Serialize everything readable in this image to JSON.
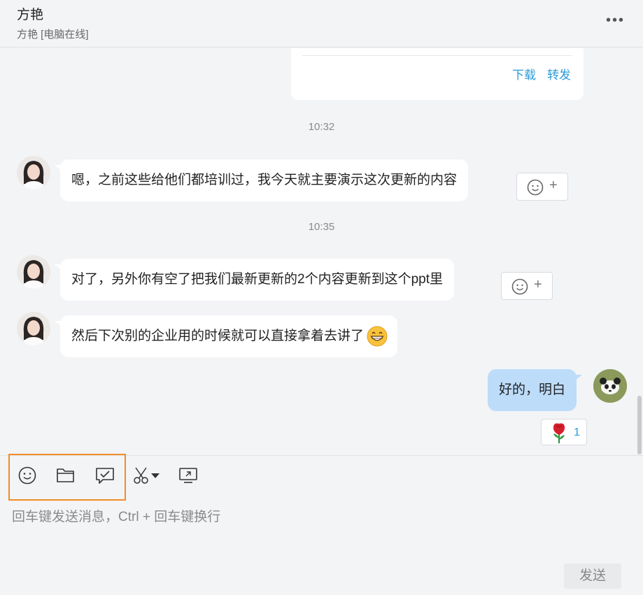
{
  "header": {
    "title": "方艳",
    "subtitle": "方艳 [电脑在线]",
    "more_label": "•••"
  },
  "file_card": {
    "download_label": "下载",
    "forward_label": "转发"
  },
  "timestamps": [
    "10:32",
    "10:35"
  ],
  "messages": [
    {
      "sender": "方艳",
      "text": "嗯，之前这些给他们都培训过，我今天就主要演示这次更新的内容"
    },
    {
      "sender": "方艳",
      "text": "对了，另外你有空了把我们最新更新的2个内容更新到这个ppt里"
    },
    {
      "sender": "方艳",
      "text": "然后下次别的企业用的时候就可以直接拿着去讲了"
    },
    {
      "sender": "me",
      "text": "好的，明白"
    }
  ],
  "reaction": {
    "icon": "rose-icon",
    "count": "1"
  },
  "react_button": {
    "plus": "+"
  },
  "toolbar": {
    "tools": [
      "emoji-icon",
      "folder-icon",
      "chat-check-icon",
      "scissors-icon",
      "screen-share-icon"
    ]
  },
  "input": {
    "placeholder": "回车键发送消息，Ctrl + 回车键换行",
    "send_label": "发送"
  },
  "colors": {
    "accent_link": "#2a9bd8",
    "self_bubble": "#bcdcfa",
    "highlight_border": "#f28c28",
    "background": "#f3f4f6"
  }
}
